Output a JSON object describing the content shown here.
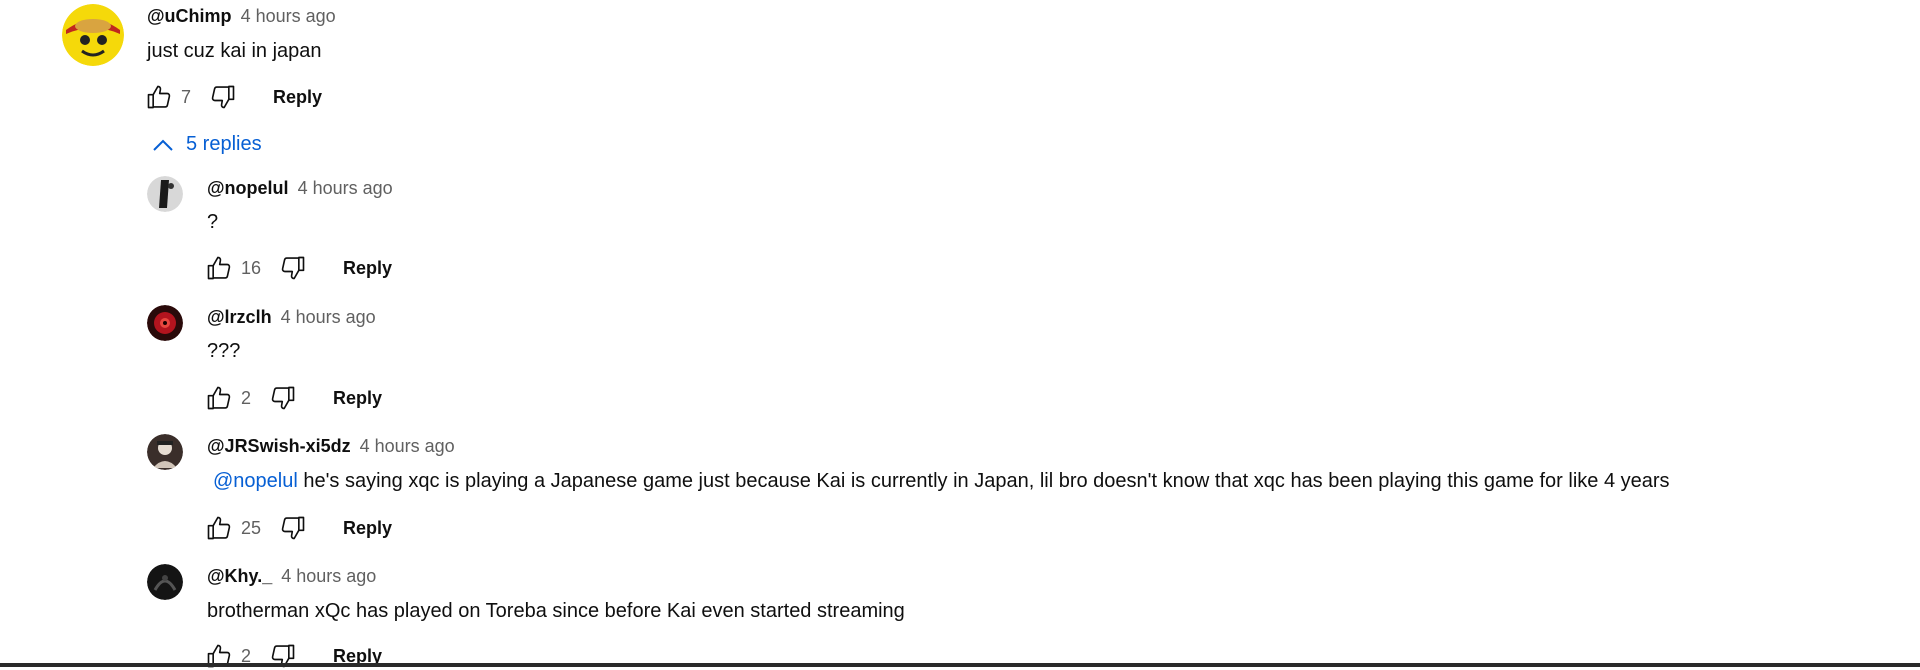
{
  "comment": {
    "author": "@uChimp",
    "time": "4 hours ago",
    "text": "just cuz kai in japan",
    "likes": "7",
    "reply_label": "Reply",
    "replies_toggle": "5 replies"
  },
  "replies": [
    {
      "author": "@nopelul",
      "time": "4 hours ago",
      "text": "?",
      "likes": "16",
      "reply_label": "Reply"
    },
    {
      "author": "@lrzclh",
      "time": "4 hours ago",
      "text": "???",
      "likes": "2",
      "reply_label": "Reply"
    },
    {
      "author": "@JRSwish-xi5dz",
      "time": "4 hours ago",
      "mention": "@nopelul",
      "text": " he's saying xqc is playing a Japanese game just because Kai is currently in Japan, lil bro doesn't know that xqc has been playing this game for like 4 years",
      "likes": "25",
      "reply_label": "Reply"
    },
    {
      "author": "@Khy._",
      "time": "4 hours ago",
      "text": "brotherman xQc has played on Toreba since before Kai even started streaming",
      "likes": "2",
      "reply_label": "Reply"
    }
  ],
  "colors": {
    "link": "#065fd4",
    "secondary_text": "#606060",
    "primary_text": "#0f0f0f"
  },
  "icons": [
    "thumbs-up-icon",
    "thumbs-down-icon",
    "chevron-up-icon"
  ]
}
